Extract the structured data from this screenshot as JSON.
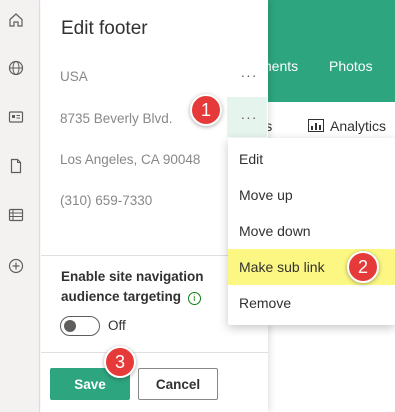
{
  "rail": {
    "icons": [
      "home-icon",
      "globe-icon",
      "news-icon",
      "document-icon",
      "list-icon",
      "add-icon"
    ]
  },
  "background": {
    "nav": [
      "ments",
      "Photos"
    ],
    "subbar": {
      "details_fragment": "ils",
      "analytics": "Analytics"
    },
    "accent_color": "#2da57e"
  },
  "panel": {
    "title": "Edit footer",
    "fields": [
      "USA",
      "8735 Beverly Blvd.",
      "Los Angeles, CA 90048",
      "(310) 659-7330"
    ],
    "more_glyph": "···",
    "toggle_label": "Enable site navigation audience targeting",
    "info_glyph": "i",
    "toggle_state": "Off",
    "save_label": "Save",
    "cancel_label": "Cancel"
  },
  "menu": {
    "items": [
      "Edit",
      "Move up",
      "Move down",
      "Make sub link",
      "Remove"
    ],
    "highlighted": "Make sub link",
    "highlight_color": "#fbf782"
  },
  "badges": [
    "1",
    "2",
    "3"
  ],
  "badge_color": "#e63a3a"
}
